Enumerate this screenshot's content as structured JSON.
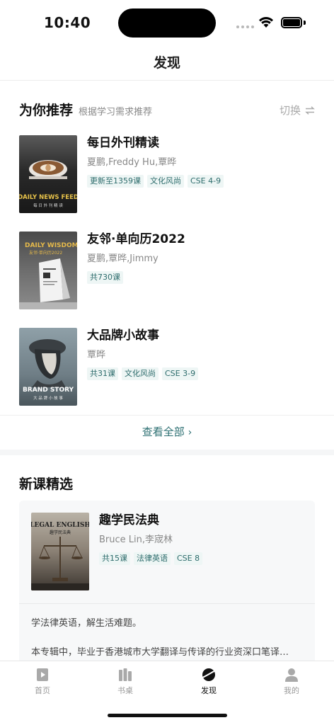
{
  "status": {
    "time": "10:40"
  },
  "header": {
    "title": "发现"
  },
  "recommend": {
    "title": "为你推荐",
    "subtitle": "根据学习需求推荐",
    "switch_label": "切换",
    "courses": [
      {
        "title": "每日外刊精读",
        "authors": "夏鹏,Freddy Hu,覃晔",
        "tags": [
          "更新至1359课",
          "文化风尚",
          "CSE 4-9"
        ],
        "cover_line1": "DAILY NEWS FEED",
        "cover_line2": "每 日 外 刊 精 读"
      },
      {
        "title": "友邻·单向历2022",
        "authors": "夏鹏,覃晔,Jimmy",
        "tags": [
          "共730课"
        ],
        "cover_line1": "DAILY WISDOM",
        "cover_line2": "友邻·单向历2022"
      },
      {
        "title": "大品牌小故事",
        "authors": "覃晔",
        "tags": [
          "共31课",
          "文化风尚",
          "CSE 3-9"
        ],
        "cover_line1": "BRAND STORY",
        "cover_line2": "大 品 牌 小 故 事"
      }
    ],
    "view_all": "查看全部"
  },
  "new_courses": {
    "title": "新课精选",
    "course": {
      "title": "趣学民法典",
      "authors": "Bruce Lin,李宬林",
      "tags": [
        "共15课",
        "法律英语",
        "CSE 8"
      ],
      "cover_line1": "LEGAL ENGLISH",
      "cover_line2": "趣学民法典",
      "desc_line1": "学法律英语，解生活难题。",
      "desc_line2": "本专辑中，毕业于香港城市大学翻译与传译的行业资深口笔译…"
    }
  },
  "tabs": [
    {
      "label": "首页",
      "icon": "play-icon",
      "active": false
    },
    {
      "label": "书桌",
      "icon": "books-icon",
      "active": false
    },
    {
      "label": "发现",
      "icon": "planet-icon",
      "active": true
    },
    {
      "label": "我的",
      "icon": "person-icon",
      "active": false
    }
  ],
  "colors": {
    "accent": "#2c6f72",
    "tag_bg": "#eef6f5",
    "tag_text": "#2c6b6b"
  }
}
